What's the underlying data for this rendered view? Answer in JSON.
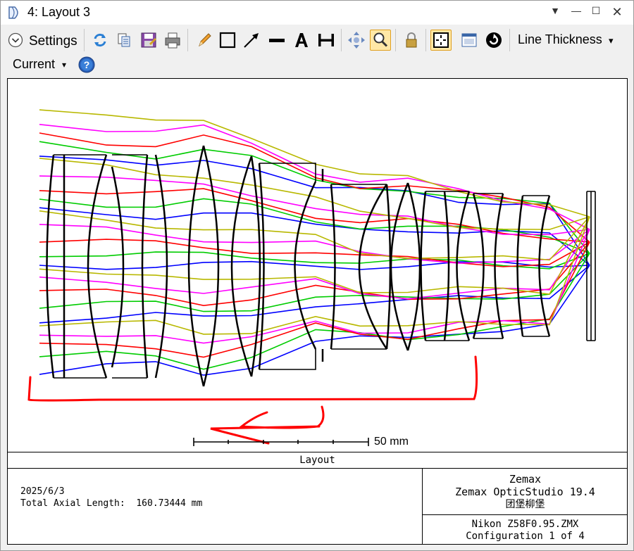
{
  "window": {
    "title": "4: Layout 3",
    "controls": {
      "pin_icon": "chevron-down-icon",
      "minimize_icon": "minimize-icon",
      "maximize_icon": "maximize-icon",
      "close_icon": "close-icon"
    }
  },
  "toolbar": {
    "settings_label": "Settings",
    "line_thickness_label": "Line Thickness",
    "line_thickness_arrow": "▾",
    "tools": [
      "refresh-icon",
      "copy-icon",
      "save-icon",
      "print-icon",
      "pencil-icon",
      "rectangle-icon",
      "arrow-icon",
      "line-icon",
      "text-icon",
      "dimension-icon",
      "pan-icon",
      "zoom-icon",
      "lock-icon",
      "crosshair-icon",
      "window-icon",
      "rotate-icon"
    ]
  },
  "config_row": {
    "current_label": "Current",
    "current_arrow": "▾",
    "help_icon": "help-icon"
  },
  "plot": {
    "caption": "Layout",
    "scale_bar_label": "50 mm",
    "date": "2025/6/3",
    "total_axial_length": "Total Axial Length:  160.73444 mm",
    "vendor": "Zemax",
    "product": "Zemax OpticStudio 19.4",
    "user": "团堡柳堡",
    "file": "Nikon Z58F0.95.ZMX",
    "configuration": "Configuration 1 of 4",
    "ray_colors": [
      "#0000ff",
      "#00cc00",
      "#ff0000",
      "#ff00ff",
      "#b8b800"
    ],
    "annotation_color": "#ff0000"
  }
}
